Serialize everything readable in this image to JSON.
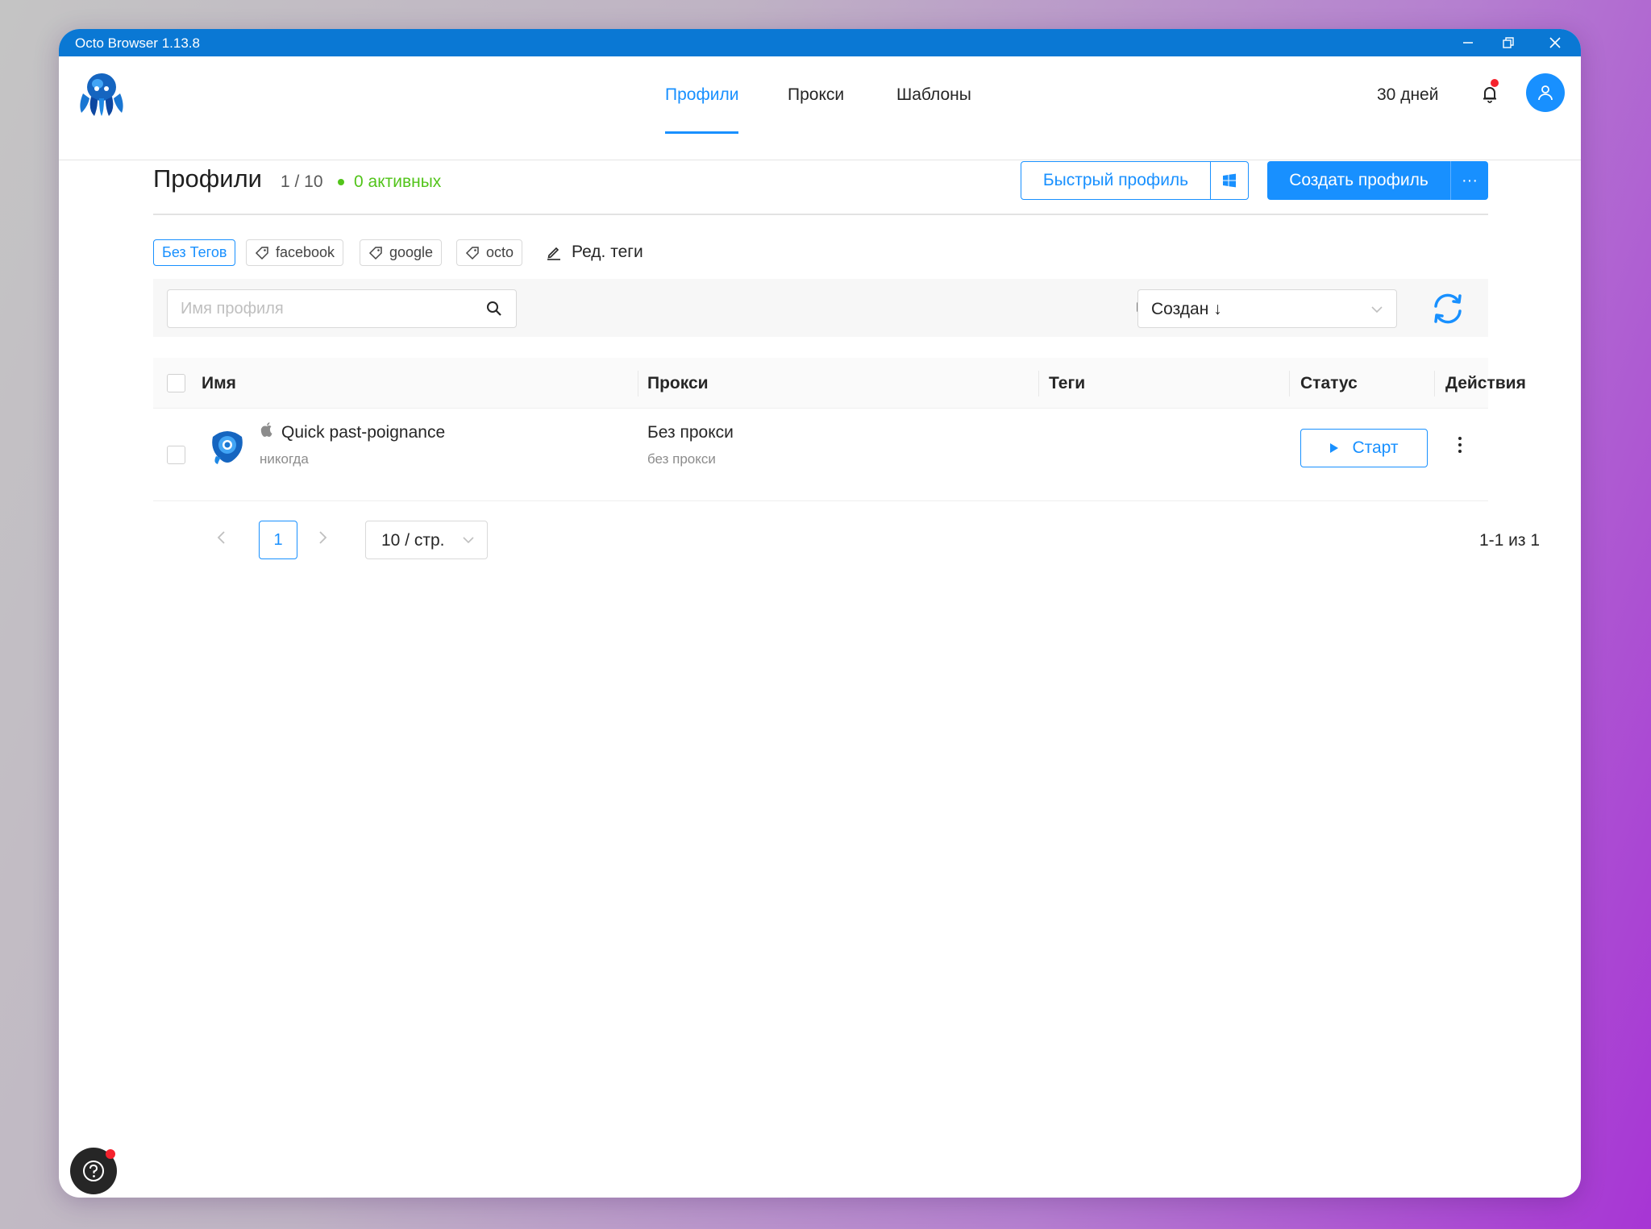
{
  "window": {
    "title": "Octo Browser 1.13.8"
  },
  "nav": {
    "tabs": [
      "Профили",
      "Прокси",
      "Шаблоны"
    ],
    "active_tab": "Профили",
    "days": "30 дней"
  },
  "header": {
    "title": "Профили",
    "count": "1 / 10",
    "active": "0 активных",
    "quick_profile": "Быстрый профиль",
    "create_profile": "Создать профиль",
    "more": "···"
  },
  "tags": {
    "items": [
      "Без Тегов",
      "facebook",
      "google",
      "octo"
    ],
    "selected": "Без Тегов",
    "edit_label": "Ред. теги"
  },
  "toolbar": {
    "search_placeholder": "Имя профиля",
    "sort_label": "Создан ↓"
  },
  "table": {
    "columns": [
      "Имя",
      "Прокси",
      "Теги",
      "Статус",
      "Действия"
    ],
    "rows": [
      {
        "name": "Quick past-poignance",
        "last_run": "никогда",
        "proxy": "Без прокси",
        "proxy_sub": "без прокси",
        "tags": "",
        "action": "Старт"
      }
    ]
  },
  "pagination": {
    "current_page": "1",
    "page_size": "10 / стр.",
    "total": "1-1 из 1"
  },
  "colors": {
    "titlebar": "#0a78d4",
    "accent": "#1890ff",
    "active_green": "#52c41a",
    "notify_red": "#f5222d"
  }
}
